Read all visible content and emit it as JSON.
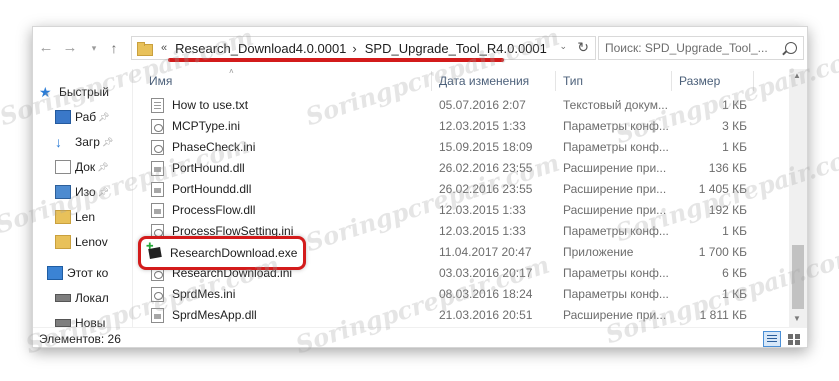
{
  "address": {
    "prefix": "«",
    "crumbs": [
      "Research_Download4.0.0001",
      "SPD_Upgrade_Tool_R4.0.0001"
    ]
  },
  "search": {
    "placeholder": "Поиск: SPD_Upgrade_Tool_..."
  },
  "nav": {
    "items": [
      {
        "label": "Быстрый",
        "icon": "star-icon"
      },
      {
        "label": "Раб",
        "icon": "desktop-icon",
        "pinned": true
      },
      {
        "label": "Загр",
        "icon": "download-icon",
        "pinned": true
      },
      {
        "label": "Док",
        "icon": "document-icon",
        "pinned": true
      },
      {
        "label": "Изо",
        "icon": "picture-icon",
        "pinned": true
      },
      {
        "label": "Len",
        "icon": "folder-icon"
      },
      {
        "label": "Lenov",
        "icon": "folder-icon"
      },
      {
        "label": "Этот ко",
        "icon": "computer-icon"
      },
      {
        "label": "Локал",
        "icon": "drive-icon"
      },
      {
        "label": "Новы",
        "icon": "drive-icon"
      }
    ]
  },
  "columns": {
    "name": "Имя",
    "date": "Дата изменения",
    "type": "Тип",
    "size": "Размер"
  },
  "files": [
    {
      "name": "How to use.txt",
      "date": "05.07.2016 2:07",
      "type": "Текстовый докум...",
      "size": "1 КБ",
      "icon": "txt"
    },
    {
      "name": "MCPType.ini",
      "date": "12.03.2015 1:33",
      "type": "Параметры конф...",
      "size": "3 КБ",
      "icon": "ini"
    },
    {
      "name": "PhaseCheck.ini",
      "date": "15.09.2015 18:09",
      "type": "Параметры конф...",
      "size": "1 КБ",
      "icon": "ini"
    },
    {
      "name": "PortHound.dll",
      "date": "26.02.2016 23:55",
      "type": "Расширение при...",
      "size": "136 КБ",
      "icon": "dll"
    },
    {
      "name": "PortHoundd.dll",
      "date": "26.02.2016 23:55",
      "type": "Расширение при...",
      "size": "1 405 КБ",
      "icon": "dll"
    },
    {
      "name": "ProcessFlow.dll",
      "date": "12.03.2015 1:33",
      "type": "Расширение при...",
      "size": "192 КБ",
      "icon": "dll"
    },
    {
      "name": "ProcessFlowSetting.ini",
      "date": "12.03.2015 1:33",
      "type": "Параметры конф...",
      "size": "1 КБ",
      "icon": "ini"
    },
    {
      "name": "ResearchDownload.exe",
      "date": "11.04.2017 20:47",
      "type": "Приложение",
      "size": "1 700 КБ",
      "icon": "exe"
    },
    {
      "name": "ResearchDownload.ini",
      "date": "03.03.2016 20:17",
      "type": "Параметры конф...",
      "size": "6 КБ",
      "icon": "ini"
    },
    {
      "name": "SprdMes.ini",
      "date": "08.03.2016 18:24",
      "type": "Параметры конф...",
      "size": "1 КБ",
      "icon": "ini"
    },
    {
      "name": "SprdMesApp.dll",
      "date": "21.03.2016 20:51",
      "type": "Расширение при...",
      "size": "1 811 КБ",
      "icon": "dll"
    }
  ],
  "highlighted": {
    "name": "ResearchDownload.exe",
    "icon": "exe"
  },
  "status": {
    "items_count": "Элементов: 26"
  },
  "watermark": "Soringpcrepair.com",
  "colors": {
    "highlight": "#d31b1b",
    "header_text": "#4c607a"
  }
}
